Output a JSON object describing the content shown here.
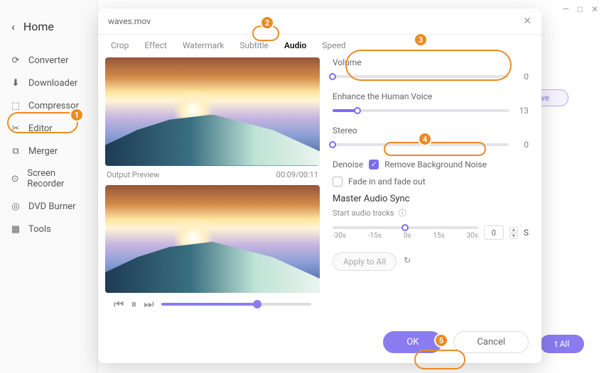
{
  "window": {
    "min": "—",
    "max": "□",
    "close": "✕"
  },
  "sidebar": {
    "home": "Home",
    "items": [
      {
        "icon": "converter",
        "label": "Converter"
      },
      {
        "icon": "downloader",
        "label": "Downloader"
      },
      {
        "icon": "compressor",
        "label": "Compressor"
      },
      {
        "icon": "editor",
        "label": "Editor"
      },
      {
        "icon": "merger",
        "label": "Merger"
      },
      {
        "icon": "recorder",
        "label": "Screen Recorder"
      },
      {
        "icon": "dvd",
        "label": "DVD Burner"
      },
      {
        "icon": "tools",
        "label": "Tools"
      }
    ]
  },
  "modal": {
    "title": "waves.mov",
    "tabs": [
      "Crop",
      "Effect",
      "Watermark",
      "Subtitle",
      "Audio",
      "Speed"
    ],
    "active_tab": "Audio",
    "preview_label": "Output Preview",
    "preview_time": "00:09/00:11",
    "footer": {
      "ok": "OK",
      "cancel": "Cancel"
    }
  },
  "audio": {
    "volume": {
      "label": "Volume",
      "value": 0,
      "pct": 0
    },
    "enhance": {
      "label": "Enhance the Human Voice",
      "value": 13,
      "pct": 14
    },
    "stereo": {
      "label": "Stereo",
      "value": 0,
      "pct": 0
    },
    "denoise": {
      "label": "Denoise",
      "option": "Remove Background Noise",
      "checked": true
    },
    "fade": {
      "label": "Fade in and fade out",
      "checked": false
    },
    "sync": {
      "title": "Master Audio Sync",
      "hint": "Start audio tracks",
      "ticks": [
        "-30s",
        "-15s",
        "0s",
        "15s",
        "30s"
      ],
      "pct": 50,
      "value": 0,
      "unit": "S"
    },
    "apply": "Apply to All"
  },
  "ghost": {
    "save": "ve",
    "all": "t All"
  },
  "badges": {
    "b1": "1",
    "b2": "2",
    "b3": "3",
    "b4": "4",
    "b5": "5"
  }
}
